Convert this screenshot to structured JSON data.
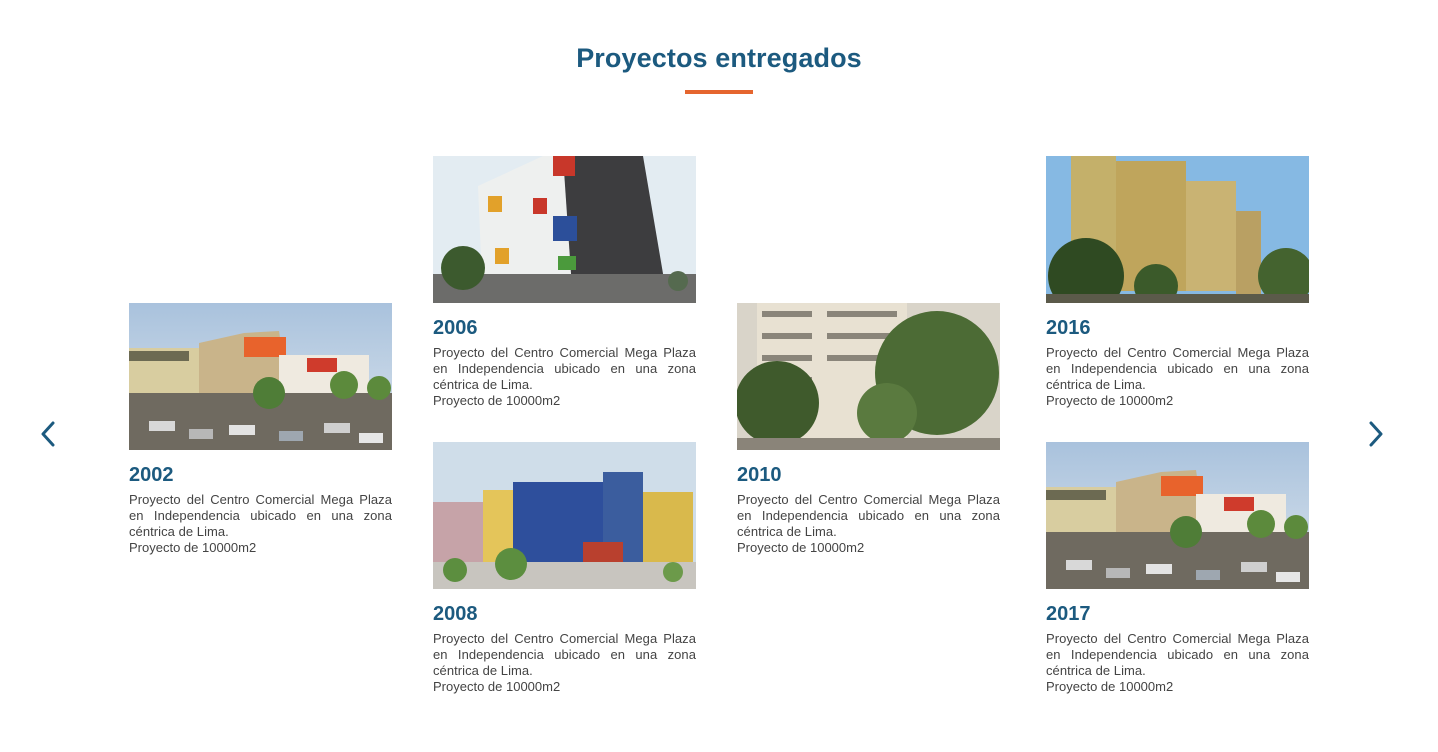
{
  "section": {
    "title": "Proyectos entregados",
    "accent_color": "#e5652e",
    "title_color": "#1c5a7f"
  },
  "navigation": {
    "prev_icon": "chevron-left-icon",
    "next_icon": "chevron-right-icon"
  },
  "projects": [
    {
      "year": "2002",
      "image": "megaplaza-shopping-center-photo",
      "description": "Proyecto del Centro Comercial Mega Plaza en Independencia ubicado en una zona céntrica de Lima.",
      "size": "Proyecto de 10000m2"
    },
    {
      "year": "2006",
      "image": "colorful-residential-tower-photo",
      "description": "Proyecto del Centro Comercial Mega Plaza en Independencia ubicado en una zona céntrica de Lima.",
      "size": "Proyecto de 10000m2"
    },
    {
      "year": "2008",
      "image": "blue-residential-buildings-render",
      "description": "Proyecto del Centro Comercial Mega Plaza en Independencia ubicado en una zona céntrica de Lima.",
      "size": "Proyecto de 10000m2"
    },
    {
      "year": "2010",
      "image": "apartment-building-with-trees-photo",
      "description": "Proyecto del Centro Comercial Mega Plaza en Independencia ubicado en una zona céntrica de Lima.",
      "size": "Proyecto de 10000m2"
    },
    {
      "year": "2016",
      "image": "beige-residential-towers-photo",
      "description": "Proyecto del Centro Comercial Mega Plaza en Independencia ubicado en una zona céntrica de Lima.",
      "size": "Proyecto de 10000m2"
    },
    {
      "year": "2017",
      "image": "megaplaza-shopping-center-photo",
      "description": "Proyecto del Centro Comercial Mega Plaza en Independencia ubicado en una zona céntrica de Lima.",
      "size": "Proyecto de 10000m2"
    }
  ]
}
